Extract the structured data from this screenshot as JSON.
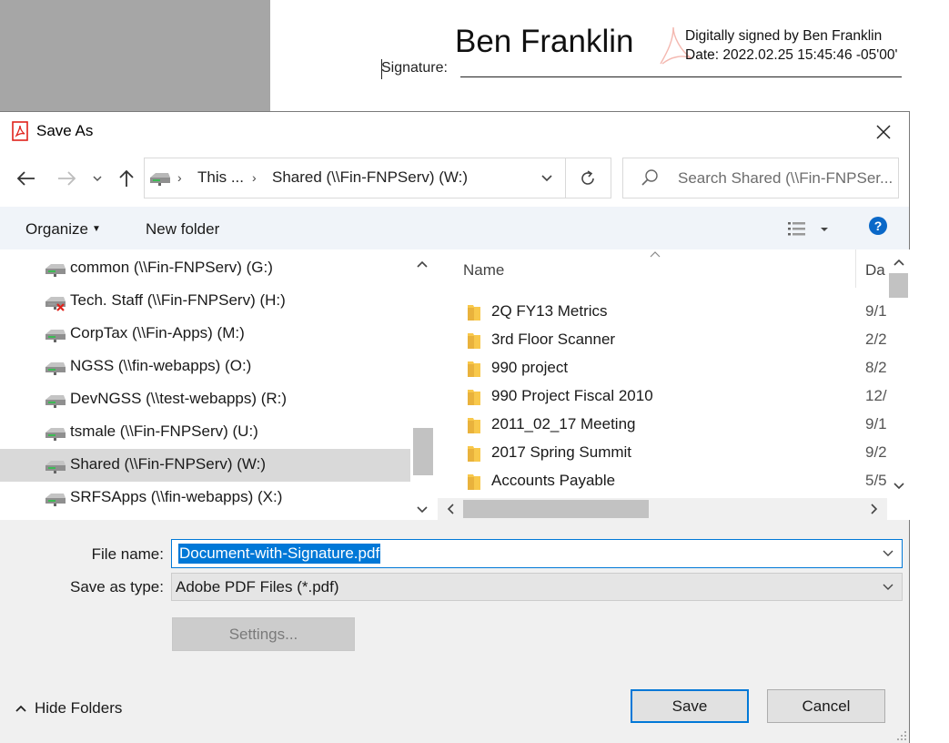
{
  "document": {
    "signer_name": "Ben Franklin",
    "signed_by_line": "Digitally signed by Ben Franklin",
    "date_line": "Date: 2022.02.25 15:45:46 -05'00'",
    "signature_label": "Signature:"
  },
  "dialog": {
    "title": "Save As",
    "address": {
      "segment_1": "This ...",
      "segment_2": "Shared (\\\\Fin-FNPServ) (W:)"
    },
    "search_placeholder": "Search Shared (\\\\Fin-FNPSer...",
    "toolbar": {
      "organize_label": "Organize",
      "new_folder_label": "New folder"
    },
    "nav_items": [
      {
        "label": "common (\\\\Fin-FNPServ) (G:)",
        "icon": "network-drive-icon"
      },
      {
        "label": "Tech. Staff (\\\\Fin-FNPServ) (H:)",
        "icon": "disconnected-drive-icon"
      },
      {
        "label": "CorpTax (\\\\Fin-Apps) (M:)",
        "icon": "network-drive-icon"
      },
      {
        "label": "NGSS (\\\\fin-webapps) (O:)",
        "icon": "network-drive-icon"
      },
      {
        "label": "DevNGSS (\\\\test-webapps) (R:)",
        "icon": "network-drive-icon"
      },
      {
        "label": "tsmale (\\\\Fin-FNPServ) (U:)",
        "icon": "network-drive-icon"
      },
      {
        "label": "Shared (\\\\Fin-FNPServ) (W:)",
        "icon": "network-drive-icon",
        "selected": true
      },
      {
        "label": "SRFSApps (\\\\fin-webapps) (X:)",
        "icon": "network-drive-icon"
      }
    ],
    "columns": {
      "name": "Name",
      "date": "Da"
    },
    "files": [
      {
        "name": "2Q FY13 Metrics",
        "date": "9/1"
      },
      {
        "name": "3rd Floor Scanner",
        "date": "2/2"
      },
      {
        "name": "990 project",
        "date": "8/2"
      },
      {
        "name": "990 Project Fiscal 2010",
        "date": "12/"
      },
      {
        "name": "2011_02_17 Meeting",
        "date": "9/1"
      },
      {
        "name": "2017 Spring Summit",
        "date": "9/2"
      },
      {
        "name": "Accounts Payable",
        "date": "5/5"
      }
    ],
    "form": {
      "file_name_label": "File name:",
      "file_name_value": "Document-with-Signature.pdf",
      "save_as_type_label": "Save as type:",
      "save_as_type_value": "Adobe PDF Files (*.pdf)",
      "settings_label": "Settings...",
      "hide_folders_label": "Hide Folders",
      "save_label": "Save",
      "cancel_label": "Cancel"
    }
  },
  "colors": {
    "accent": "#0078d7",
    "selected_row": "#d9d9d9",
    "folder": "#f8c84b",
    "pdf_red": "#e0221b"
  }
}
